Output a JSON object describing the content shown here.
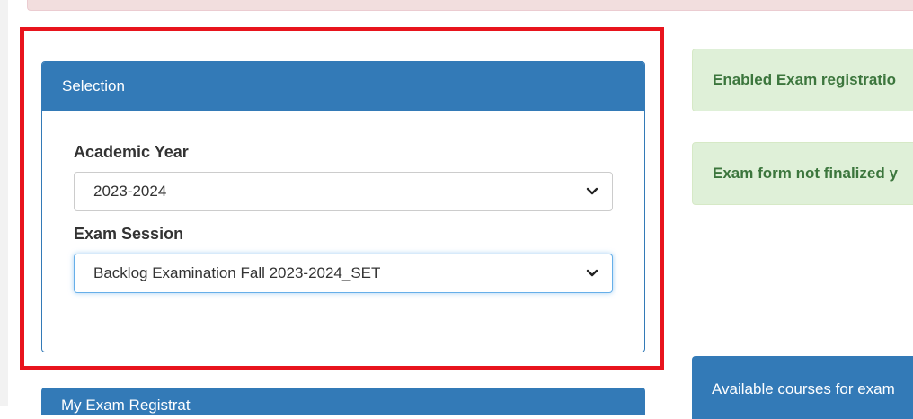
{
  "selection_panel": {
    "title": "Selection",
    "academic_year": {
      "label": "Academic Year",
      "value": "2023-2024"
    },
    "exam_session": {
      "label": "Exam Session",
      "value": "Backlog Examination Fall 2023-2024_SET"
    }
  },
  "alerts": [
    {
      "text": "Enabled Exam registratio"
    },
    {
      "text": "Exam form not finalized y"
    }
  ],
  "bottom_panels": {
    "left_title": "My Exam Registrat",
    "right_title": "Available courses for exam"
  },
  "colors": {
    "primary": "#337ab7",
    "success_bg": "#dff0d8",
    "success_text": "#3c763d",
    "highlight": "#e8141d"
  }
}
